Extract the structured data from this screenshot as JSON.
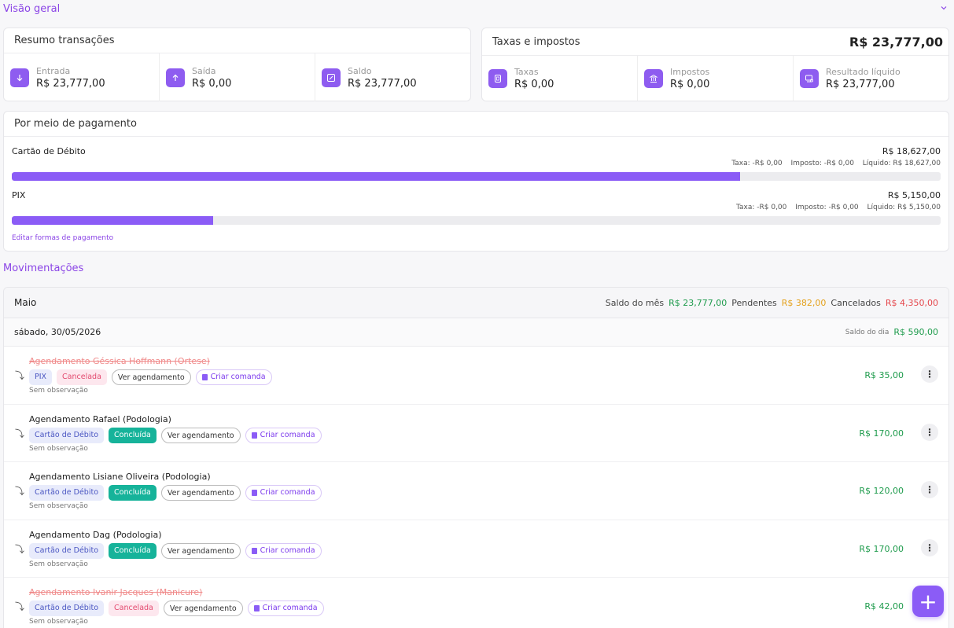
{
  "overview": {
    "title": "Visão geral",
    "transactions": {
      "title": "Resumo transações",
      "stats": [
        {
          "label": "Entrada",
          "value": "R$ 23,777,00",
          "icon": "arrow-down-icon"
        },
        {
          "label": "Saída",
          "value": "R$ 0,00",
          "icon": "arrow-up-icon"
        },
        {
          "label": "Saldo",
          "value": "R$ 23,777,00",
          "icon": "balance-icon"
        }
      ]
    },
    "taxes": {
      "title": "Taxas e impostos",
      "total": "R$ 23,777,00",
      "stats": [
        {
          "label": "Taxas",
          "value": "R$ 0,00",
          "icon": "receipt-icon"
        },
        {
          "label": "Impostos",
          "value": "R$ 0,00",
          "icon": "bank-icon"
        },
        {
          "label": "Resultado líquido",
          "value": "R$ 23,777,00",
          "icon": "wallet-icon"
        }
      ]
    }
  },
  "payment_methods": {
    "title": "Por meio de pagamento",
    "items": [
      {
        "name": "Cartão de Débito",
        "amount": "R$ 18,627,00",
        "fee": "Taxa: -R$ 0,00",
        "tax": "Imposto: -R$ 0,00",
        "net": "Líquido: R$ 18,627,00",
        "share": 0.784
      },
      {
        "name": "PIX",
        "amount": "R$ 5,150,00",
        "fee": "Taxa: -R$ 0,00",
        "tax": "Imposto: -R$ 0,00",
        "net": "Líquido: R$ 5,150,00",
        "share": 0.217
      }
    ],
    "edit_link": "Editar formas de pagamento"
  },
  "movements": {
    "title": "Movimentações",
    "month": {
      "name": "Maio",
      "balance_label": "Saldo do mês",
      "balance": "R$ 23,777,00",
      "pending_label": "Pendentes",
      "pending": "R$ 382,00",
      "canceled_label": "Cancelados",
      "canceled": "R$ 4,350,00"
    },
    "day": {
      "date": "sábado, 30/05/2026",
      "balance_label": "Saldo do dia",
      "balance": "R$ 590,00"
    },
    "items": [
      {
        "title": "Agendamento Géssica Hoffmann (Ortese)",
        "payment": "PIX",
        "status": "Cancelada",
        "view": "Ver agendamento",
        "command": "Criar comanda",
        "obs": "Sem observação",
        "amount": "R$ 35,00"
      },
      {
        "title": "Agendamento Rafael (Podologia)",
        "payment": "Cartão de Débito",
        "status": "Concluída",
        "view": "Ver agendamento",
        "command": "Criar comanda",
        "obs": "Sem observação",
        "amount": "R$ 170,00"
      },
      {
        "title": "Agendamento Lisiane Oliveira (Podologia)",
        "payment": "Cartão de Débito",
        "status": "Concluída",
        "view": "Ver agendamento",
        "command": "Criar comanda",
        "obs": "Sem observação",
        "amount": "R$ 120,00"
      },
      {
        "title": "Agendamento Dag (Podologia)",
        "payment": "Cartão de Débito",
        "status": "Concluída",
        "view": "Ver agendamento",
        "command": "Criar comanda",
        "obs": "Sem observação",
        "amount": "R$ 170,00"
      },
      {
        "title": "Agendamento Ivanir Jacques (Manicure)",
        "payment": "Cartão de Débito",
        "status": "Cancelada",
        "view": "Ver agendamento",
        "command": "Criar comanda",
        "obs": "Sem observação",
        "amount": "R$ 42,00"
      }
    ]
  },
  "fab_label": "+"
}
